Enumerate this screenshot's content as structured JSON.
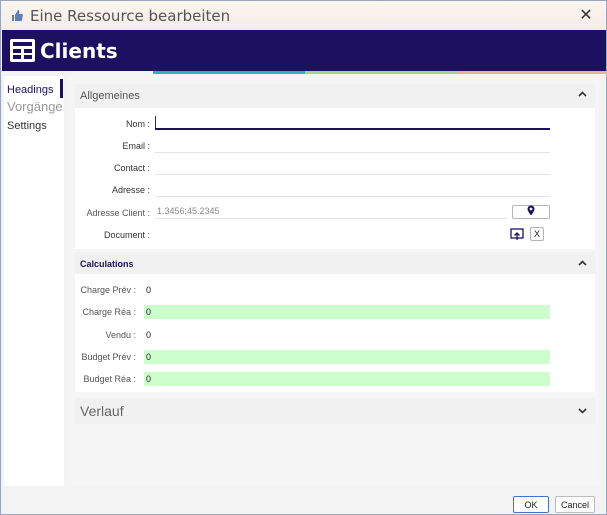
{
  "window": {
    "title": "Eine Ressource bearbeiten",
    "close_glyph": "✕"
  },
  "app": {
    "title": "Clients",
    "icon": "table-grid-icon"
  },
  "stripes": [
    "#2bb5b3",
    "#a9d18e",
    "#f4b183"
  ],
  "sidebar": {
    "items": [
      {
        "label": "Headings",
        "active": true
      },
      {
        "label": "Vorgänge",
        "active": false
      },
      {
        "label": "Settings",
        "active": false
      }
    ]
  },
  "general": {
    "title": "Allgemeines",
    "nom_label": "Nom :",
    "nom_value": "",
    "email_label": "Email :",
    "contact_label": "Contact :",
    "adresse_label": "Adresse :",
    "adresse_client_label": "Adresse Client :",
    "adresse_client_placeholder": "1.3456;45.2345",
    "document_label": "Document :",
    "remove_label": "X"
  },
  "calculations": {
    "title": "Calculations",
    "charge_prev_label": "Charge Prév :",
    "charge_prev_value": "0",
    "charge_rea_label": "Charge Réa :",
    "charge_rea_value": "0",
    "vendu_label": "Vendu :",
    "vendu_value": "0",
    "budget_prev_label": "Budget Prév :",
    "budget_prev_value": "0",
    "budget_rea_label": "Budget Réa :",
    "budget_rea_value": "0",
    "highlight_color": "#ccffcc"
  },
  "verlauf": {
    "title": "Verlauf"
  },
  "footer": {
    "ok_label": "OK",
    "cancel_label": "Cancel"
  },
  "accent_color": "#1e1060"
}
